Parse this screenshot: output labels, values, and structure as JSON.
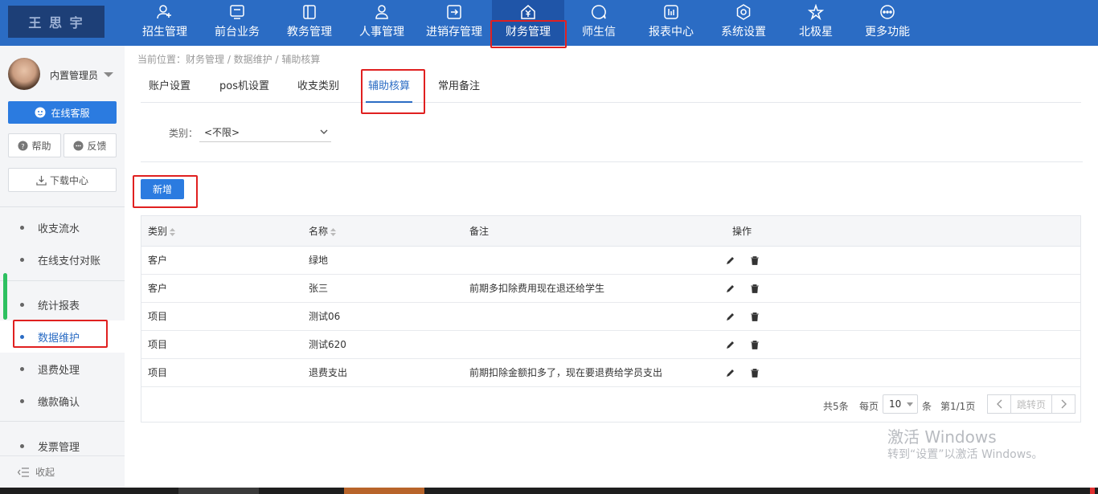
{
  "logo": {
    "text": "王 思 宇"
  },
  "nav": [
    {
      "label": "招生管理",
      "icon": "user-plus-icon"
    },
    {
      "label": "前台业务",
      "icon": "monitor-icon"
    },
    {
      "label": "教务管理",
      "icon": "book-icon"
    },
    {
      "label": "人事管理",
      "icon": "person-icon"
    },
    {
      "label": "进销存管理",
      "icon": "inbox-arrow-icon"
    },
    {
      "label": "财务管理",
      "icon": "yen-house-icon"
    },
    {
      "label": "师生信",
      "icon": "chat-icon"
    },
    {
      "label": "报表中心",
      "icon": "bar-chart-icon"
    },
    {
      "label": "系统设置",
      "icon": "gear-icon"
    },
    {
      "label": "北极星",
      "icon": "star-icon"
    },
    {
      "label": "更多功能",
      "icon": "more-icon"
    }
  ],
  "user": {
    "name": "内置管理员"
  },
  "sidebar": {
    "online_service": "在线客服",
    "help": "帮助",
    "feedback": "反馈",
    "download_center": "下载中心",
    "items": [
      {
        "label": "收支流水"
      },
      {
        "label": "在线支付对账"
      },
      {
        "label": "统计报表"
      },
      {
        "label": "数据维护"
      },
      {
        "label": "退费处理"
      },
      {
        "label": "缴款确认"
      },
      {
        "label": "发票管理"
      }
    ],
    "collapse": "收起"
  },
  "breadcrumb": "当前位置：财务管理 / 数据维护 / 辅助核算",
  "tabs": [
    {
      "label": "账户设置"
    },
    {
      "label": "pos机设置"
    },
    {
      "label": "收支类别"
    },
    {
      "label": "辅助核算"
    },
    {
      "label": "常用备注"
    }
  ],
  "filter": {
    "label": "类别：",
    "value": "<不限>"
  },
  "add_button": "新增",
  "table": {
    "headers": {
      "category": "类别",
      "name": "名称",
      "remark": "备注",
      "action": "操作"
    },
    "rows": [
      {
        "category": "客户",
        "name": "绿地",
        "remark": ""
      },
      {
        "category": "客户",
        "name": "张三",
        "remark": "前期多扣除费用现在退还给学生"
      },
      {
        "category": "项目",
        "name": "测试06",
        "remark": ""
      },
      {
        "category": "项目",
        "name": "测试620",
        "remark": ""
      },
      {
        "category": "项目",
        "name": "退费支出",
        "remark": "前期扣除金额扣多了，现在要退费给学员支出"
      }
    ]
  },
  "pager": {
    "total": "共5条",
    "per_page_label": "每页",
    "per_page_value": "10",
    "unit": "条",
    "page_info": "第1/1页",
    "jump": "跳转页"
  },
  "watermark": {
    "line1": "激活 Windows",
    "line2": "转到“设置”以激活 Windows。"
  },
  "colors": {
    "primary": "#2b6cc4",
    "highlight": "#e02020"
  }
}
